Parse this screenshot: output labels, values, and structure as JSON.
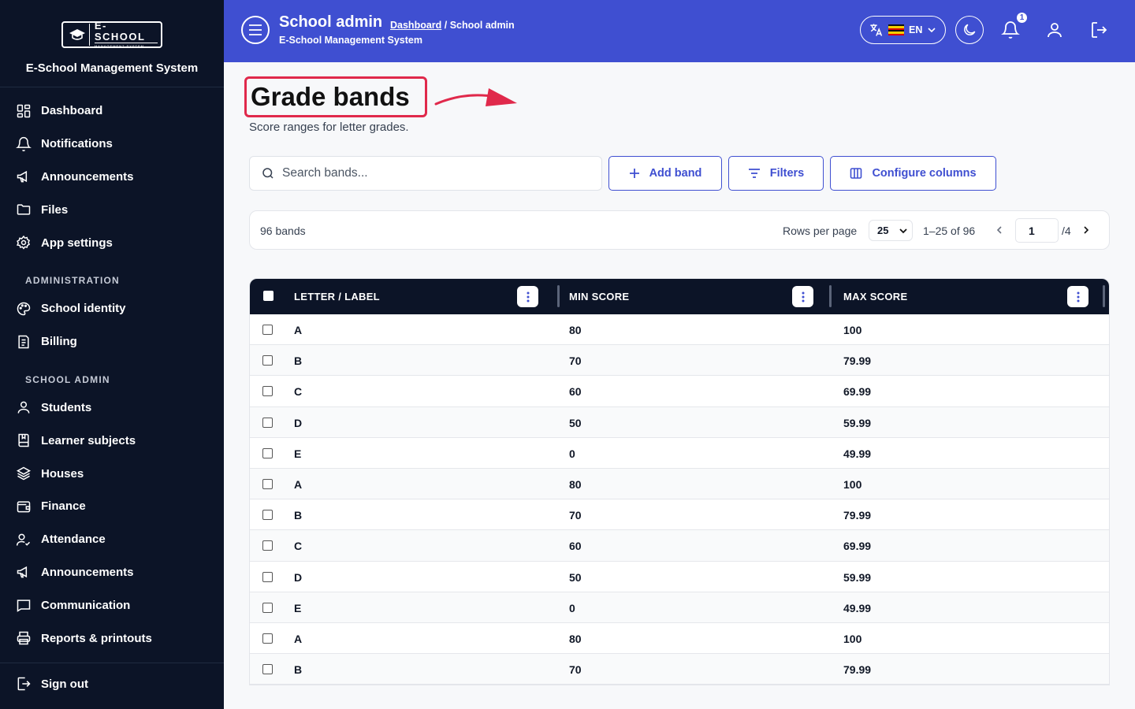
{
  "sidebar": {
    "logo_main": "E-SCHOOL",
    "logo_sub": "MANAGEMENT SYSTEM",
    "brand_title": "E-School Management System",
    "items": [
      {
        "label": "Dashboard",
        "icon": "grid-icon"
      },
      {
        "label": "Notifications",
        "icon": "bell-icon"
      },
      {
        "label": "Announcements",
        "icon": "megaphone-icon"
      },
      {
        "label": "Files",
        "icon": "folder-icon"
      },
      {
        "label": "App settings",
        "icon": "gear-icon"
      }
    ],
    "section_admin": "ADMINISTRATION",
    "admin_items": [
      {
        "label": "School identity",
        "icon": "palette-icon"
      },
      {
        "label": "Billing",
        "icon": "invoice-icon"
      }
    ],
    "section_school": "SCHOOL ADMIN",
    "school_items": [
      {
        "label": "Students",
        "icon": "user-icon"
      },
      {
        "label": "Learner subjects",
        "icon": "book-icon"
      },
      {
        "label": "Houses",
        "icon": "layers-icon"
      },
      {
        "label": "Finance",
        "icon": "wallet-icon"
      },
      {
        "label": "Attendance",
        "icon": "user-check-icon"
      },
      {
        "label": "Announcements",
        "icon": "megaphone-icon"
      },
      {
        "label": "Communication",
        "icon": "message-icon"
      },
      {
        "label": "Reports & printouts",
        "icon": "printer-icon"
      }
    ],
    "sign_out": "Sign out"
  },
  "header": {
    "title": "School admin",
    "breadcrumb_link": "Dashboard",
    "breadcrumb_current": " / School admin",
    "subtitle": "E-School Management System",
    "language": "EN",
    "notification_count": "1"
  },
  "page": {
    "title": "Grade bands",
    "subtitle": "Score ranges for letter grades."
  },
  "controls": {
    "search_placeholder": "Search bands...",
    "add_label": "Add band",
    "filters_label": "Filters",
    "configure_label": "Configure columns"
  },
  "pagination": {
    "count": "96 bands",
    "rows_per_page_label": "Rows per page",
    "rows_per_page": "25",
    "range": "1–25 of 96",
    "page": "1",
    "total_pages": "/4"
  },
  "table": {
    "columns": [
      "LETTER / LABEL",
      "MIN SCORE",
      "MAX SCORE"
    ],
    "rows": [
      [
        "A",
        "80",
        "100"
      ],
      [
        "B",
        "70",
        "79.99"
      ],
      [
        "C",
        "60",
        "69.99"
      ],
      [
        "D",
        "50",
        "59.99"
      ],
      [
        "E",
        "0",
        "49.99"
      ],
      [
        "A",
        "80",
        "100"
      ],
      [
        "B",
        "70",
        "79.99"
      ],
      [
        "C",
        "60",
        "69.99"
      ],
      [
        "D",
        "50",
        "59.99"
      ],
      [
        "E",
        "0",
        "49.99"
      ],
      [
        "A",
        "80",
        "100"
      ],
      [
        "B",
        "70",
        "79.99"
      ]
    ]
  },
  "colors": {
    "primary": "#3f4fd1",
    "sidebar_bg": "#0c1427",
    "highlight": "#e0294b"
  }
}
